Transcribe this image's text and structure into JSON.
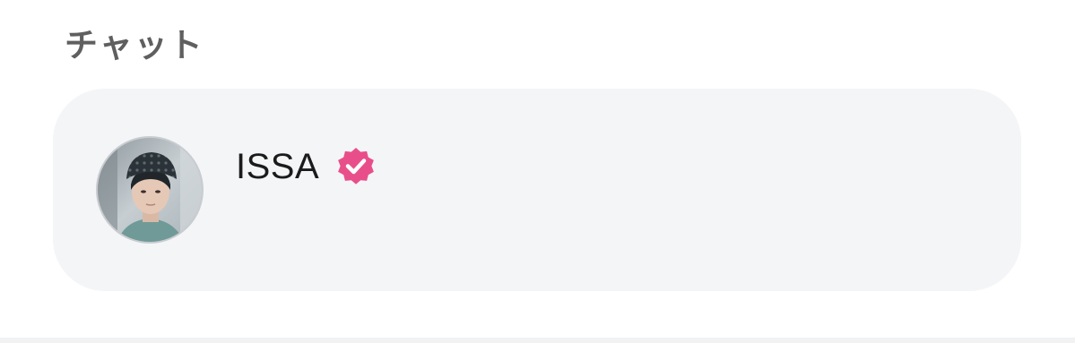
{
  "section": {
    "title": "チャット"
  },
  "chat": {
    "name": "ISSA",
    "verified": true,
    "avatar_icon": "profile-photo",
    "badge_icon": "verified-badge-icon"
  },
  "colors": {
    "card_background": "#f4f5f7",
    "badge": "#e84f8a",
    "title_text": "#5f5f5f",
    "name_text": "#1b1b1b"
  }
}
